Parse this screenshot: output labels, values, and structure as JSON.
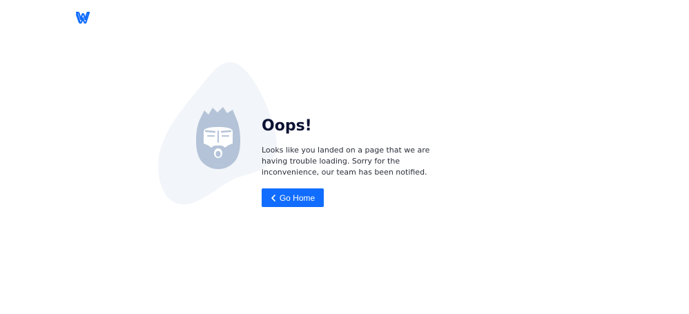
{
  "brand": {
    "logo_icon": "weebly-w-logo-icon",
    "logo_color": "#116dff"
  },
  "illustration": {
    "blob_color": "#f2f5f9",
    "face_icon": "surprised-face-icon",
    "face_color": "#b4c3d8"
  },
  "error": {
    "title": "Oops!",
    "message": "Looks like you landed on a page that we are having trouble loading. Sorry for the inconvenience, our team has been notified.",
    "title_color": "#0b1233"
  },
  "actions": {
    "home_label": "Go Home",
    "home_icon": "chevron-left-icon",
    "button_color": "#116dff"
  }
}
